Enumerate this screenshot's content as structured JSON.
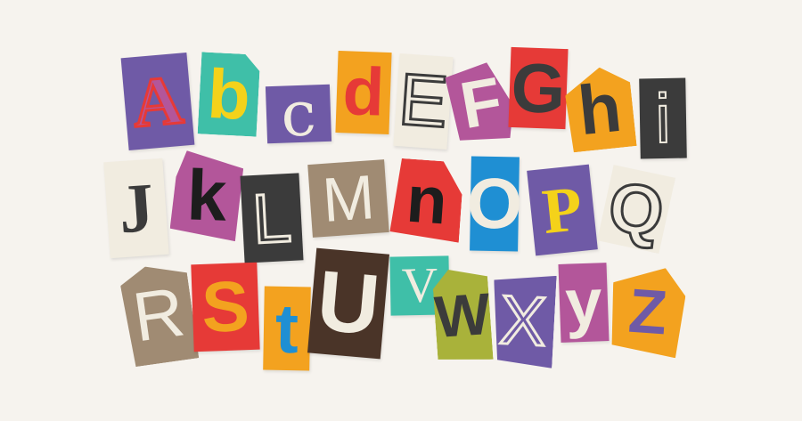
{
  "letters": [
    "A",
    "b",
    "c",
    "d",
    "E",
    "F",
    "G",
    "h",
    "i",
    "J",
    "k",
    "L",
    "M",
    "n",
    "O",
    "P",
    "Q",
    "R",
    "S",
    "t",
    "U",
    "V",
    "W",
    "X",
    "y",
    "Z"
  ],
  "colors": {
    "background": "#f6f3ee",
    "purple": "#6f5aa6",
    "teal": "#3fbfa8",
    "orange": "#f3a21f",
    "red": "#e63a37",
    "magenta": "#b3569a",
    "cream": "#f1ece0",
    "dark": "#3b3b3b",
    "tan": "#a08b73",
    "blue": "#1f8fd3",
    "olive": "#a9b23a",
    "brown": "#4a3428",
    "yellow": "#f4d21a"
  }
}
